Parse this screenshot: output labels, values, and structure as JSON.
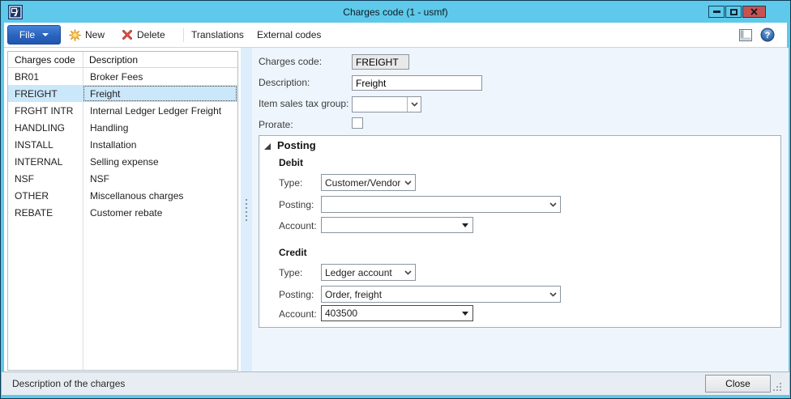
{
  "window": {
    "title": "Charges code (1 - usmf)"
  },
  "toolbar": {
    "file": "File",
    "new": "New",
    "delete": "Delete",
    "translations": "Translations",
    "external_codes": "External codes",
    "help_glyph": "?"
  },
  "grid": {
    "columns": [
      "Charges code",
      "Description"
    ],
    "selected_code": "FREIGHT",
    "rows": [
      {
        "code": "BR01",
        "description": "Broker Fees"
      },
      {
        "code": "FREIGHT",
        "description": "Freight"
      },
      {
        "code": "FRGHT INTR",
        "description": "Internal Ledger Ledger Freight"
      },
      {
        "code": "HANDLING",
        "description": "Handling"
      },
      {
        "code": "INSTALL",
        "description": "Installation"
      },
      {
        "code": "INTERNAL",
        "description": "Selling expense"
      },
      {
        "code": "NSF",
        "description": "NSF"
      },
      {
        "code": "OTHER",
        "description": "Miscellanous charges"
      },
      {
        "code": "REBATE",
        "description": "Customer rebate"
      }
    ]
  },
  "form": {
    "charges_code": {
      "label": "Charges code:",
      "value": "FREIGHT"
    },
    "description": {
      "label": "Description:",
      "value": "Freight"
    },
    "item_sales_tax_group": {
      "label": "Item sales tax group:",
      "value": ""
    },
    "prorate": {
      "label": "Prorate:",
      "checked": false
    },
    "posting": {
      "title": "Posting",
      "debit": {
        "heading": "Debit",
        "type_label": "Type:",
        "type_value": "Customer/Vendor",
        "posting_label": "Posting:",
        "posting_value": "",
        "account_label": "Account:",
        "account_value": ""
      },
      "credit": {
        "heading": "Credit",
        "type_label": "Type:",
        "type_value": "Ledger account",
        "posting_label": "Posting:",
        "posting_value": "Order, freight",
        "account_label": "Account:",
        "account_value": "403500"
      }
    }
  },
  "statusbar": {
    "text": "Description of the charges",
    "close": "Close"
  },
  "colors": {
    "titlebar": "#5ec9ea",
    "close_button": "#c85252",
    "file_button": "#2a63bd",
    "selection": "#cbe7fa",
    "panel_bg": "#eef5fc"
  }
}
